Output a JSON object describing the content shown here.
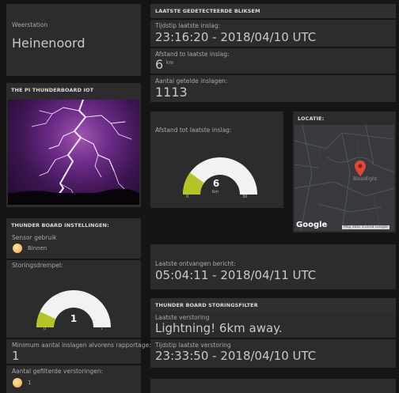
{
  "station": {
    "label": "Weerstation",
    "value": "Heinenoord"
  },
  "lightning": {
    "header": "LAATSTE GEDETECTEERDE BLIKSEM",
    "last_strike_label": "Tijdstip laatste inslag:",
    "last_strike_value": "23:16:20 - 2018/04/10 UTC",
    "distance_label": "Afstand to laatste inslag:",
    "distance_value": "6",
    "distance_unit": "km",
    "count_label": "Aantal getelde inslagen:",
    "count_value": "1113"
  },
  "iot": {
    "header": "THE PI THUNDERBOARD IOT"
  },
  "distance_gauge": {
    "label": "Afstand tot laatste inslag:",
    "value": "6",
    "unit": "Km",
    "min": "0",
    "max": "30",
    "fraction": 0.2
  },
  "location": {
    "header": "LOCATIE:",
    "map_label": "Bloodlight",
    "google": "Google",
    "map_data": "Map data ©2018 Google"
  },
  "settings": {
    "header": "THUNDER BOARD INSTELLINGEN:",
    "sensor_label": "Sensor gebruik",
    "sensor_value": "Binnen",
    "threshold_label": "Storingsdrempel:",
    "threshold_value": "1",
    "threshold_min": "0",
    "threshold_max": "7",
    "threshold_fraction": 0.14,
    "min_strikes_label": "Minimum aantal inslagen alvorens rapportage:",
    "min_strikes_value": "1",
    "filtered_label": "Aantal gefilterde verstoringen:",
    "filtered_value": "1"
  },
  "last_message": {
    "label": "Laatste ontvangen bericht:",
    "value": "05:04:11 - 2018/04/11 UTC"
  },
  "disturbance": {
    "header": "THUNDER BOARD STORINGSFILTER",
    "last_label": "Laatste verstoring",
    "last_value": "Lightning! 6km away.",
    "time_label": "Tijdstip laatste verstoring",
    "time_value": "23:33:50 - 2018/04/10 UTC"
  },
  "colors": {
    "gauge_fill": "#b5c527",
    "gauge_bg": "#f2f2f2",
    "panel": "#2c2c2c",
    "pin": "#e0463a"
  }
}
